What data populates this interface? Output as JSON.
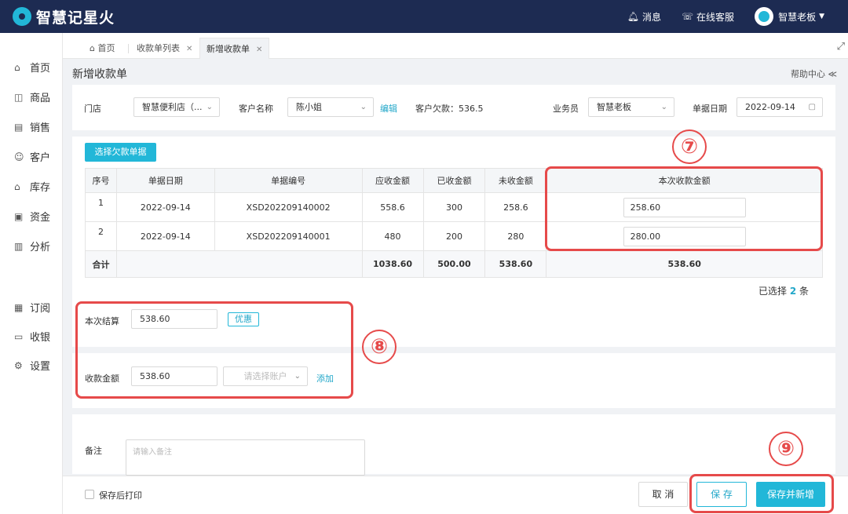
{
  "app": {
    "name": "智慧记星火",
    "logo_icon": "drop-logo-icon"
  },
  "topbar": {
    "message_label": "消息",
    "service_label": "在线客服",
    "user_name": "智慧老板"
  },
  "sidebar": {
    "items": [
      {
        "label": "首页",
        "icon": "home-icon"
      },
      {
        "label": "商品",
        "icon": "goods-icon"
      },
      {
        "label": "销售",
        "icon": "sales-icon"
      },
      {
        "label": "客户",
        "icon": "customer-icon"
      },
      {
        "label": "库存",
        "icon": "stock-icon"
      },
      {
        "label": "资金",
        "icon": "funds-icon"
      },
      {
        "label": "分析",
        "icon": "chart-icon"
      },
      {
        "label": "订阅",
        "icon": "subscribe-icon"
      },
      {
        "label": "收银",
        "icon": "cashier-icon"
      },
      {
        "label": "设置",
        "icon": "settings-icon"
      }
    ]
  },
  "tabs": [
    {
      "label": "首页"
    },
    {
      "label": "收款单列表"
    },
    {
      "label": "新增收款单"
    }
  ],
  "page": {
    "title": "新增收款单",
    "help_label": "帮助中心 ≪"
  },
  "form": {
    "store_label": "门店",
    "store_value": "智慧便利店（...",
    "customer_label": "客户名称",
    "customer_value": "陈小姐",
    "edit_link": "编辑",
    "debt_text": "客户欠款：536.5",
    "salesman_label": "业务员",
    "salesman_value": "智慧老板",
    "date_label": "单据日期",
    "date_value": "2022-09-14"
  },
  "select_debt_button": "选择欠款单据",
  "table": {
    "headers": [
      "序号",
      "单据日期",
      "单据编号",
      "应收金额",
      "已收金额",
      "未收金额",
      "本次收款金额"
    ],
    "rows": [
      {
        "no": "1",
        "date": "2022-09-14",
        "code": "XSD202209140002",
        "receivable": "558.6",
        "received": "300",
        "unreceived": "258.6",
        "current": "258.60"
      },
      {
        "no": "2",
        "date": "2022-09-14",
        "code": "XSD202209140001",
        "receivable": "480",
        "received": "200",
        "unreceived": "280",
        "current": "280.00"
      }
    ],
    "total": {
      "label": "合计",
      "receivable": "1038.60",
      "received": "500.00",
      "unreceived": "538.60",
      "current": "538.60"
    }
  },
  "selected": {
    "prefix": "已选择",
    "count": "2",
    "suffix": "条"
  },
  "settlement": {
    "label": "本次结算",
    "value": "538.60",
    "discount_button": "优惠"
  },
  "receipt": {
    "label": "收款金额",
    "value": "538.60",
    "account_placeholder": "请选择账户",
    "add_link": "添加"
  },
  "remark": {
    "label": "备注",
    "placeholder": "请输入备注"
  },
  "footer": {
    "print_after_save": "保存后打印",
    "cancel_button": "取 消",
    "save_button": "保 存",
    "save_new_button": "保存并新增"
  },
  "annotations": [
    "⑦",
    "⑧",
    "⑨"
  ],
  "colors": {
    "topbar": "#1d2b52",
    "accent": "#22b7d8",
    "highlight": "#e64a4a"
  }
}
